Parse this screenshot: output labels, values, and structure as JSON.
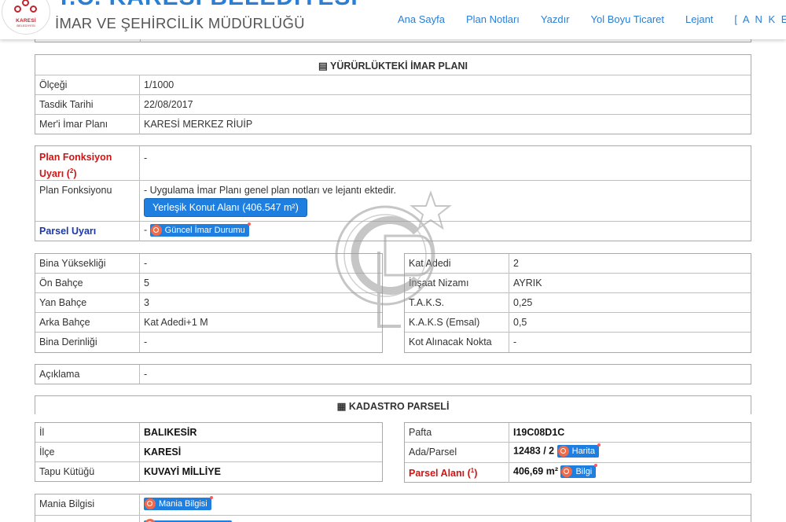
{
  "header": {
    "top_title": "T.C. KARESİ BELEDİYESİ",
    "sub_title": "İMAR VE ŞEHİRCİLİK MÜDÜRLÜĞÜ",
    "logo_text": "KARESİ",
    "logo_sub": "BELEDİYESİ",
    "nav": [
      "Ana Sayfa",
      "Plan Notları",
      "Yazdır",
      "Yol Boyu Ticaret",
      "Lejant",
      "[ A N K E T ]"
    ]
  },
  "imar_plani": {
    "heading": "YÜRÜRLÜKTEKİ İMAR PLANI",
    "rows": [
      {
        "label": "Ölçeği",
        "value": "1/1000"
      },
      {
        "label": "Tasdik Tarihi",
        "value": "22/08/2017"
      },
      {
        "label": "Mer'i İmar Planı",
        "value": "KARESİ MERKEZ RİUİP"
      }
    ]
  },
  "fonksiyon": {
    "warning_label": "Plan Fonksiyon Uyarı (",
    "warning_sup": "2",
    "warning_close": ")",
    "warning_value": "-",
    "fonksiyon_label": "Plan Fonksiyonu",
    "fonksiyon_note": "- Uygulama İmar Planı genel plan notları ve lejantı ektedir.",
    "fonksiyon_button": "Yerleşik Konut Alanı (406.547 m²)",
    "parsel_label": "Parsel Uyarı",
    "parsel_dash": "-",
    "parsel_chip": "Güncel İmar Durumu"
  },
  "yapilasma_left": [
    {
      "label": "Bina Yüksekliği",
      "value": "-"
    },
    {
      "label": "Ön Bahçe",
      "value": "5"
    },
    {
      "label": "Yan Bahçe",
      "value": "3"
    },
    {
      "label": "Arka Bahçe",
      "value": "Kat Adedi+1 M"
    },
    {
      "label": "Bina Derinliği",
      "value": "-"
    }
  ],
  "yapilasma_right": [
    {
      "label": "Kat Adedi",
      "value": "2"
    },
    {
      "label": "İnşaat Nizamı",
      "value": "AYRIK"
    },
    {
      "label": "T.A.K.S.",
      "value": "0,25"
    },
    {
      "label": "K.A.K.S (Emsal)",
      "value": "0,5"
    },
    {
      "label": "Kot Alınacak Nokta",
      "value": "-"
    }
  ],
  "aciklama": {
    "label": "Açıklama",
    "value": "-"
  },
  "kadastro": {
    "heading": "KADASTRO PARSELİ",
    "left": [
      {
        "label": "İl",
        "value": "BALIKESİR"
      },
      {
        "label": "İlçe",
        "value": "KARESİ"
      },
      {
        "label": "Tapu Kütüğü",
        "value": "KUVAYİ MİLLİYE"
      }
    ],
    "pafta_label": "Pafta",
    "pafta_value": "I19C08D1C",
    "ada_label": "Ada/Parsel",
    "ada_value": "12483 / 2",
    "ada_chip": "Harita",
    "alan_label": "Parsel Alanı (",
    "alan_sup": "1",
    "alan_close": ")",
    "alan_value": "406,69 m²",
    "alan_chip": "Bilgi"
  },
  "mania": {
    "label": "Mania Bilgisi",
    "chip": "Mania Bilgisi"
  },
  "colors": {
    "accent": "#1e7fe0",
    "warning": "#d01414",
    "link": "#2a7fd4"
  }
}
